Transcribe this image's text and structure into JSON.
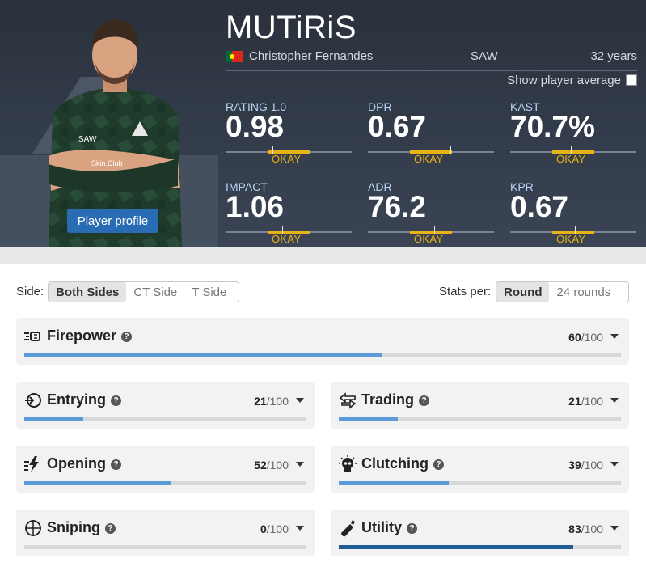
{
  "player": {
    "nickname": "MUTiRiS",
    "real_name": "Christopher Fernandes",
    "team": "SAW",
    "age": "32 years",
    "profile_button": "Player profile",
    "show_average_label": "Show player average",
    "jersey_texts": [
      "SAW",
      "Skin.Club"
    ]
  },
  "stats": [
    {
      "label": "RATING 1.0",
      "value": "0.98",
      "rating": "OKAY"
    },
    {
      "label": "DPR",
      "value": "0.67",
      "rating": "OKAY"
    },
    {
      "label": "KAST",
      "value": "70.7%",
      "rating": "OKAY"
    },
    {
      "label": "IMPACT",
      "value": "1.06",
      "rating": "OKAY"
    },
    {
      "label": "ADR",
      "value": "76.2",
      "rating": "OKAY"
    },
    {
      "label": "KPR",
      "value": "0.67",
      "rating": "OKAY"
    }
  ],
  "filters": {
    "side_label": "Side:",
    "side_options": [
      "Both Sides",
      "CT Side",
      "T Side"
    ],
    "side_selected": "Both Sides",
    "stats_per_label": "Stats per:",
    "stats_per_options": [
      "Round",
      "24 rounds"
    ],
    "stats_per_selected": "Round"
  },
  "categories": [
    {
      "name": "Firepower",
      "score": "60",
      "max": "/100",
      "fraction": 0.6,
      "icon": "firepower-icon"
    },
    {
      "name": "Entrying",
      "score": "21",
      "max": "/100",
      "fraction": 0.21,
      "icon": "entrying-icon"
    },
    {
      "name": "Trading",
      "score": "21",
      "max": "/100",
      "fraction": 0.21,
      "icon": "trading-icon"
    },
    {
      "name": "Opening",
      "score": "52",
      "max": "/100",
      "fraction": 0.52,
      "icon": "opening-icon"
    },
    {
      "name": "Clutching",
      "score": "39",
      "max": "/100",
      "fraction": 0.39,
      "icon": "clutching-icon"
    },
    {
      "name": "Sniping",
      "score": "0",
      "max": "/100",
      "fraction": 0.0,
      "icon": "crosshair-icon"
    },
    {
      "name": "Utility",
      "score": "83",
      "max": "/100",
      "fraction": 0.83,
      "icon": "utility-icon"
    }
  ],
  "colors": {
    "accent_blue": "#2a6cb3",
    "bar_blue": "#5b9bd9",
    "bar_blue_strong": "#215a98",
    "okay_yellow": "#e8b215"
  }
}
